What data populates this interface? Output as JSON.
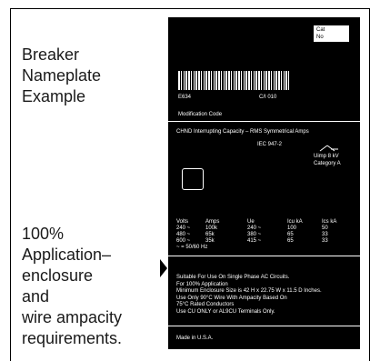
{
  "left": {
    "title_lines": [
      "Breaker",
      "Nameplate",
      "Example"
    ],
    "note_lines": [
      "100%",
      "Application–",
      "enclosure",
      "and",
      "wire ampacity",
      "requirements."
    ]
  },
  "plate": {
    "cat_label": "Cat",
    "no_label": "No",
    "barcode_left": "E634",
    "barcode_right": "C/I  010",
    "modification_code": "Modification Code",
    "interrupting_title": "CHND Interrupting Capacity – RMS Symmetrical Amps",
    "iec_standard": "IEC 947-2",
    "uimp": "Uimp 8 kV",
    "category": "Category A",
    "ratings_headers": [
      "Volts",
      "Amps",
      "Ue",
      "Icu kA",
      "Ics kA"
    ],
    "ratings_rows": [
      [
        "240 ~",
        "100k",
        "240 ~",
        "100",
        "50"
      ],
      [
        "480 ~",
        "65k",
        "380 ~",
        "65",
        "33"
      ],
      [
        "600 ~",
        "35k",
        "415 ~",
        "65",
        "33"
      ]
    ],
    "frequency": "~ = 50/60 Hz",
    "usage_lines": [
      "Suitable For Use On Single Phase AC Circuits.",
      "For 100% Application",
      "Minimum Enclosure Size is 42 H x 22.75 W x 11.5 D Inches.",
      "Use Only 90°C Wire With Ampacity Based On",
      "  75°C Rated Conductors",
      "Use CU ONLY or AL9CU Terminals Only."
    ],
    "made_in": "Made in U.S.A."
  }
}
